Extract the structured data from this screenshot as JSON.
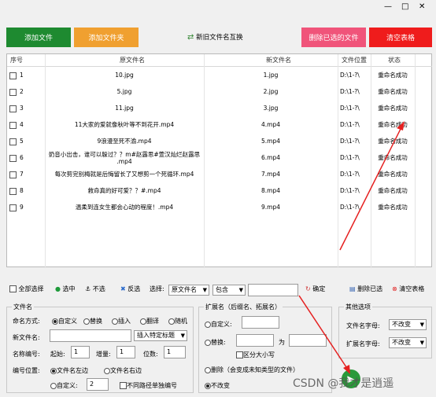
{
  "window": {
    "min": "—",
    "max": "□",
    "close": "✕"
  },
  "toolbar": {
    "add_file": "添加文件",
    "add_folder": "添加文件夹",
    "swap": "新旧文件名互换",
    "remove_selected": "删除已选的文件",
    "clear_table": "清空表格"
  },
  "colors": {
    "green": "#1e8a30",
    "orange": "#f0a030",
    "pink": "#f0547a",
    "red": "#ef1c1c"
  },
  "table": {
    "headers": [
      "序号",
      "原文件名",
      "新文件名",
      "文件位置",
      "状态"
    ],
    "rows": [
      {
        "no": "1",
        "orig": "10.jpg",
        "new": "1.jpg",
        "loc": "D:\\1-?\\",
        "status": "重命名成功"
      },
      {
        "no": "2",
        "orig": "5.jpg",
        "new": "2.jpg",
        "loc": "D:\\1-?\\",
        "status": "重命名成功"
      },
      {
        "no": "3",
        "orig": "11.jpg",
        "new": "3.jpg",
        "loc": "D:\\1-?\\",
        "status": "重命名成功"
      },
      {
        "no": "4",
        "orig": "11大家的爱就像秋叶等不到花开.mp4",
        "new": "4.mp4",
        "loc": "D:\\1-?\\",
        "status": "重命名成功"
      },
      {
        "no": "5",
        "orig": "9浪漫至死不渝.mp4",
        "new": "5.mp4",
        "loc": "D:\\1-?\\",
        "status": "重命名成功"
      },
      {
        "no": "6",
        "orig": "奶音小出击，谁可以躲过？？m#赵露思#萱汉灿烂赵露思",
        "orig2": ".mp4",
        "new": "6.mp4",
        "loc": "D:\\1-?\\",
        "status": "重命名成功"
      },
      {
        "no": "7",
        "orig": "每次剪完别梅就是后悔留长了又想剪一个死循环.mp4",
        "new": "7.mp4",
        "loc": "D:\\1-?\\",
        "status": "重命名成功"
      },
      {
        "no": "8",
        "orig": "救命真的好可爱？？#.mp4",
        "new": "8.mp4",
        "loc": "D:\\1-?\\",
        "status": "重命名成功"
      },
      {
        "no": "9",
        "orig": "温柔到连女生都会心动的程度！.mp4",
        "new": "9.mp4",
        "loc": "D:\\1-?\\",
        "status": "重命名成功"
      }
    ]
  },
  "bar": {
    "select_all": "全部选择",
    "select": "选中",
    "deselect": "不选",
    "invert": "反选",
    "choose": "选择:",
    "field": "原文件名",
    "op": "包含",
    "confirm": "确定",
    "remove_sel": "删除已选",
    "clear": "清空表格"
  },
  "filename": {
    "title": "文件名",
    "method": "命名方式:",
    "m1": "自定义",
    "m2": "替换",
    "m3": "插入",
    "m4": "翻译",
    "m5": "随机",
    "newname": "新文件名:",
    "insert_tag": "插入特定标题",
    "numbering": "名称编号:",
    "start": "起始:",
    "start_v": "1",
    "inc": "增量:",
    "inc_v": "1",
    "digits": "位数:",
    "digits_v": "1",
    "pos": "编号位置:",
    "pos1": "文件名左边",
    "pos2": "文件名右边",
    "pos3": "自定义:",
    "pos3_v": "2",
    "no_seq": "不同路径单独编号"
  },
  "ext": {
    "title": "扩展名（后缀名、拓展名）",
    "custom": "自定义:",
    "replace": "替换:",
    "to": "为",
    "case": "区分大小写",
    "delete": "删除（会变成未知类型的文件）",
    "keep": "不改变"
  },
  "other": {
    "title": "其他选项",
    "name_case": "文件名字母:",
    "name_case_v": "不改变",
    "ext_case": "扩展名字母:",
    "ext_case_v": "不改变"
  },
  "watermark": "CSDN @我才是逍遥"
}
